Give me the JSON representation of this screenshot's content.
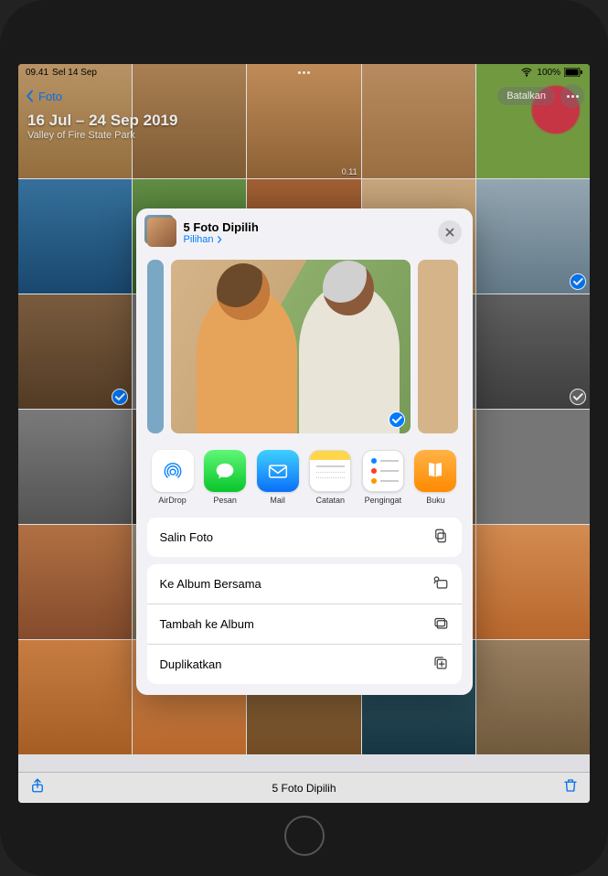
{
  "status": {
    "time": "09.41",
    "date": "Sel 14 Sep",
    "battery": "100%"
  },
  "nav": {
    "back_label": "Foto",
    "cancel_label": "Batalkan"
  },
  "header": {
    "date_range": "16 Jul – 24 Sep 2019",
    "location": "Valley of Fire State Park"
  },
  "grid": {
    "video_duration": "0.11"
  },
  "toolbar": {
    "selection_label": "5 Foto Dipilih"
  },
  "sheet": {
    "title": "5 Foto Dipilih",
    "subtitle": "Pilihan",
    "apps": [
      {
        "label": "AirDrop",
        "icon": "airdrop",
        "bg": "#ffffff"
      },
      {
        "label": "Pesan",
        "icon": "messages",
        "bg": "linear-gradient(#5ff777,#09c52b)"
      },
      {
        "label": "Mail",
        "icon": "mail",
        "bg": "linear-gradient(#3fd0ff,#0a6ff8)"
      },
      {
        "label": "Catatan",
        "icon": "notes",
        "bg": "#ffffff"
      },
      {
        "label": "Pengingat",
        "icon": "reminders",
        "bg": "#ffffff"
      },
      {
        "label": "Buku",
        "icon": "books",
        "bg": "linear-gradient(#ffb347,#ff8a00)"
      }
    ],
    "actions": {
      "copy": "Salin Foto",
      "shared_album": "Ke Album Bersama",
      "add_album": "Tambah ke Album",
      "duplicate": "Duplikatkan"
    }
  }
}
